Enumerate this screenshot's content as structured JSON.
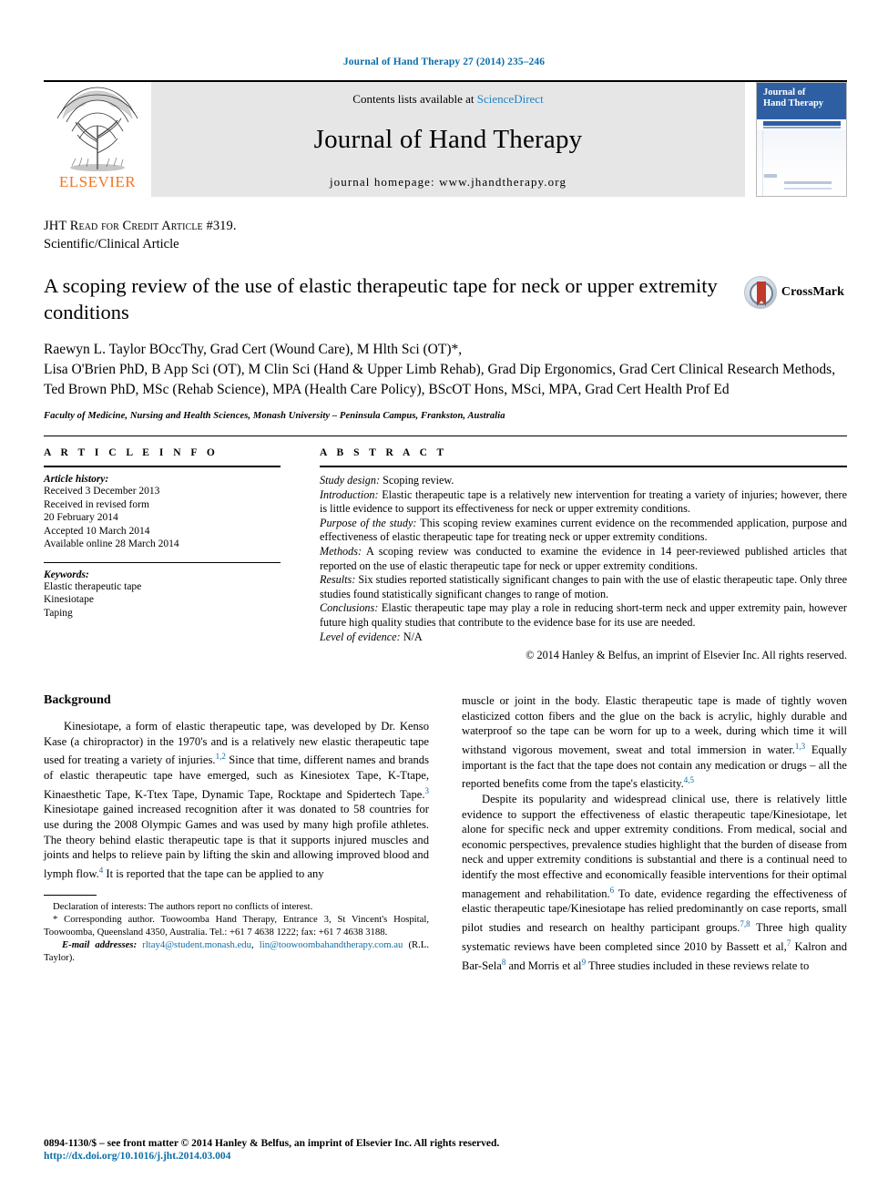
{
  "running_head": "Journal of Hand Therapy 27 (2014) 235–246",
  "masthead": {
    "contents_prefix": "Contents lists available at",
    "sciencedirect": "ScienceDirect",
    "journal_title": "Journal of Hand Therapy",
    "homepage": "journal homepage: www.jhandtherapy.org",
    "publisher": "ELSEVIER",
    "cover_title_line1": "Journal of",
    "cover_title_line2": "Hand Therapy"
  },
  "article_type": {
    "credit_line": "JHT Read for Credit Article #319.",
    "category": "Scientific/Clinical Article"
  },
  "title": "A scoping review of the use of elastic therapeutic tape for neck or upper extremity conditions",
  "crossmark_label": "CrossMark",
  "authors": [
    "Raewyn L. Taylor BOccThy, Grad Cert (Wound Care), M Hlth Sci (OT)*,",
    "Lisa O'Brien PhD, B App Sci (OT), M Clin Sci (Hand & Upper Limb Rehab), Grad Dip Ergonomics, Grad Cert Clinical Research Methods,",
    "Ted Brown PhD, MSc (Rehab Science), MPA (Health Care Policy), BScOT Hons, MSci, MPA, Grad Cert Health Prof Ed"
  ],
  "affiliation": "Faculty of Medicine, Nursing and Health Sciences, Monash University – Peninsula Campus, Frankston, Australia",
  "article_info": {
    "heading": "A R T I C L E  I N F O",
    "history_label": "Article history:",
    "history": [
      "Received 3 December 2013",
      "Received in revised form",
      "20 February 2014",
      "Accepted 10 March 2014",
      "Available online 28 March 2014"
    ],
    "keywords_label": "Keywords:",
    "keywords": [
      "Elastic therapeutic tape",
      "Kinesiotape",
      "Taping"
    ]
  },
  "abstract": {
    "heading": "A B S T R A C T",
    "sections": [
      {
        "label": "Study design:",
        "text": " Scoping review."
      },
      {
        "label": "Introduction:",
        "text": " Elastic therapeutic tape is a relatively new intervention for treating a variety of injuries; however, there is little evidence to support its effectiveness for neck or upper extremity conditions."
      },
      {
        "label": "Purpose of the study:",
        "text": " This scoping review examines current evidence on the recommended application, purpose and effectiveness of elastic therapeutic tape for treating neck or upper extremity conditions."
      },
      {
        "label": "Methods:",
        "text": " A scoping review was conducted to examine the evidence in 14 peer-reviewed published articles that reported on the use of elastic therapeutic tape for neck or upper extremity conditions."
      },
      {
        "label": "Results:",
        "text": " Six studies reported statistically significant changes to pain with the use of elastic therapeutic tape. Only three studies found statistically significant changes to range of motion."
      },
      {
        "label": "Conclusions:",
        "text": " Elastic therapeutic tape may play a role in reducing short-term neck and upper extremity pain, however future high quality studies that contribute to the evidence base for its use are needed."
      },
      {
        "label": "Level of evidence:",
        "text": " N/A"
      }
    ],
    "copyright": "© 2014 Hanley & Belfus, an imprint of Elsevier Inc. All rights reserved."
  },
  "body": {
    "section_heading": "Background",
    "left_paragraph_1": "Kinesiotape, a form of elastic therapeutic tape, was developed by Dr. Kenso Kase (a chiropractor) in the 1970's and is a relatively new elastic therapeutic tape used for treating a variety of injuries.",
    "left_ref_1": "1,2",
    "left_paragraph_1b": " Since that time, different names and brands of elastic therapeutic tape have emerged, such as Kinesiotex Tape, K-Ttape, Kinaesthetic Tape, K-Ttex Tape, Dynamic Tape, Rocktape and Spidertech Tape.",
    "left_ref_2": "3",
    "left_paragraph_1c": " Kinesiotape gained increased recognition after it was donated to 58 countries for use during the 2008 Olympic Games and was used by many high profile athletes. The theory behind elastic therapeutic tape is that it supports injured muscles and joints and helps to relieve pain by lifting the skin and allowing improved blood and lymph flow.",
    "left_ref_3": "4",
    "left_paragraph_1d": " It is reported that the tape can be applied to any",
    "right_paragraph_1": "muscle or joint in the body. Elastic therapeutic tape is made of tightly woven elasticized cotton fibers and the glue on the back is acrylic, highly durable and waterproof so the tape can be worn for up to a week, during which time it will withstand vigorous movement, sweat and total immersion in water.",
    "right_ref_1": "1,3",
    "right_paragraph_1b": " Equally important is the fact that the tape does not contain any medication or drugs – all the reported benefits come from the tape's elasticity.",
    "right_ref_2": "4,5",
    "right_paragraph_2": "Despite its popularity and widespread clinical use, there is relatively little evidence to support the effectiveness of elastic therapeutic tape/Kinesiotape, let alone for specific neck and upper extremity conditions. From medical, social and economic perspectives, prevalence studies highlight that the burden of disease from neck and upper extremity conditions is substantial and there is a continual need to identify the most effective and economically feasible interventions for their optimal management and rehabilitation.",
    "right_ref_3": "6",
    "right_paragraph_2b": " To date, evidence regarding the effectiveness of elastic therapeutic tape/Kinesiotape has relied predominantly on case reports, small pilot studies and research on healthy participant groups.",
    "right_ref_4": "7,8",
    "right_paragraph_2c": " Three high quality systematic reviews have been completed since 2010 by Bassett et al,",
    "right_ref_5": "7",
    "right_paragraph_2d": " Kalron and Bar-Sela",
    "right_ref_6": "8",
    "right_paragraph_2e": " and Morris et al",
    "right_ref_7": "9",
    "right_paragraph_2f": " Three studies included in these reviews relate to"
  },
  "footnotes": {
    "declaration": "Declaration of interests: The authors report no conflicts of interest.",
    "corresponding": "* Corresponding author. Toowoomba Hand Therapy, Entrance 3, St Vincent's Hospital, Toowoomba, Queensland 4350, Australia. Tel.: +61 7 4638 1222; fax: +61 7 4638 3188.",
    "email_label": "E-mail addresses:",
    "email_1": "rltay4@student.monash.edu",
    "email_2": "lin@toowoombahandtherapy.com.au",
    "email_suffix": " (R.L. Taylor)."
  },
  "footer": {
    "issn_line": "0894-1130/$ – see front matter © 2014 Hanley & Belfus, an imprint of Elsevier Inc. All rights reserved.",
    "doi": "http://dx.doi.org/10.1016/j.jht.2014.03.004"
  },
  "colors": {
    "link_blue": "#0b6ea8",
    "sciencedirect_blue": "#1f84c6",
    "elsevier_orange": "#ef7622",
    "cover_blue": "#2e5fa3",
    "crossmark_red": "#c0392b"
  }
}
